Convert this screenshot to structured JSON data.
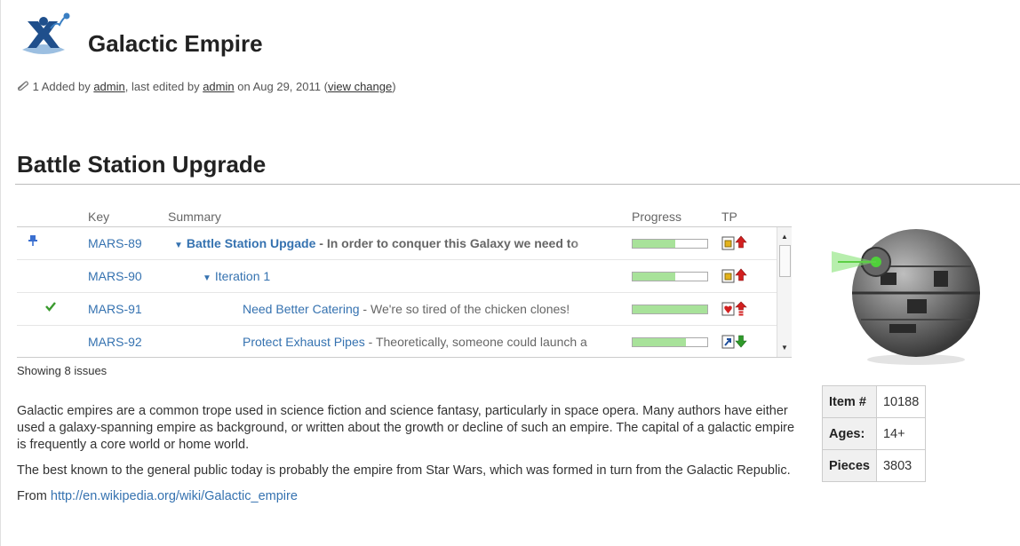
{
  "page": {
    "title": "Galactic Empire",
    "meta": {
      "version": "1",
      "added_by_prefix": "Added by",
      "added_by_user": "admin",
      "edited_prefix": ", last edited by",
      "edited_by_user": "admin",
      "date_prefix": "on Aug 29, 2011",
      "view_change": "view change"
    }
  },
  "section": {
    "title": "Battle Station Upgrade"
  },
  "issues": {
    "columns": {
      "key": "Key",
      "summary": "Summary",
      "progress": "Progress",
      "tp": "TP"
    },
    "rows": [
      {
        "key": "MARS-89",
        "title": "Battle Station Upgade",
        "desc": "In order to conquer this Galaxy we need to",
        "progress": 0.57,
        "indicator": "pin",
        "level": 0
      },
      {
        "key": "MARS-90",
        "title": "Iteration 1",
        "desc": "",
        "progress": 0.57,
        "indicator": "",
        "level": 1
      },
      {
        "key": "MARS-91",
        "title": "Need Better Catering",
        "desc": "We're so tired of the chicken clones!",
        "progress": 1.0,
        "indicator": "check",
        "level": 2
      },
      {
        "key": "MARS-92",
        "title": "Protect Exhaust Pipes",
        "desc": "Theoretically, someone could launch a",
        "progress": 0.72,
        "indicator": "",
        "level": 2
      }
    ],
    "showing": "Showing 8 issues"
  },
  "body": {
    "p1": "Galactic empires are a common trope used in science fiction and science fantasy, particularly in space opera. Many authors have either used a galaxy-spanning empire as background, or written about the growth or decline of such an empire. The capital of a galactic empire is frequently a core world or home world.",
    "p2": "The best known to the general public today is probably the empire from Star Wars, which was formed in turn from the Galactic Republic.",
    "from_label": "From",
    "from_link": "http://en.wikipedia.org/wiki/Galactic_empire"
  },
  "info": [
    {
      "label": "Item #",
      "value": "10188"
    },
    {
      "label": "Ages:",
      "value": "14+"
    },
    {
      "label": "Pieces",
      "value": "3803"
    }
  ],
  "icons": {
    "logo": "confluence-x-logo-icon",
    "pin": "pin-icon",
    "check": "checkmark-icon",
    "caret": "caret-down-icon",
    "priority_up": "priority-up-arrow-icon",
    "priority_down": "priority-down-arrow-icon"
  },
  "colors": {
    "link": "#3572b0",
    "progress": "#a8e29a",
    "check": "#3a9a2e"
  }
}
